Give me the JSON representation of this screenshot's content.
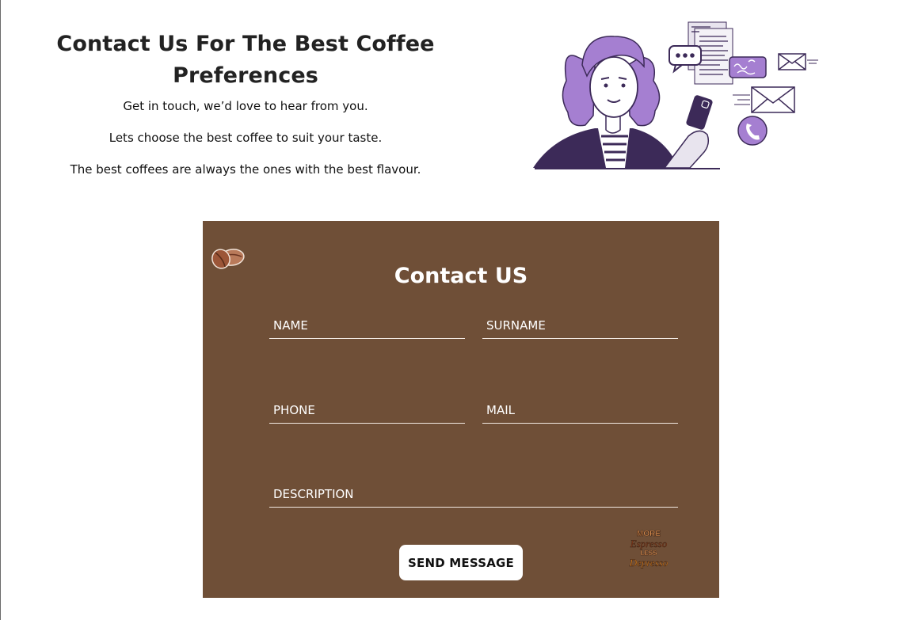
{
  "hero": {
    "title": "Contact Us For The Best Coffee Preferences",
    "line1": "Get in touch, we’d love to hear from you.",
    "line2": "Lets choose the best coffee to suit your taste.",
    "line3": "The best coffees are always the ones with the best flavour."
  },
  "illustration": {
    "name": "woman-with-phone-contact-illustration",
    "colors": {
      "accent": "#a57fd1",
      "dark": "#3c2a58"
    }
  },
  "form": {
    "title": "Contact US",
    "background": "#6f4f37",
    "fields": {
      "name_placeholder": "NAME",
      "surname_placeholder": "SURNAME",
      "phone_placeholder": "PHONE",
      "mail_placeholder": "MAIL",
      "description_placeholder": "DESCRIPTION"
    },
    "submit_label": "SEND MESSAGE",
    "decor": {
      "beans_icon": "coffee-beans-icon",
      "sticker_icon": "espresso-sticker-icon",
      "sticker_text": [
        "MORE",
        "Espresso",
        "LESS",
        "Depresso"
      ]
    }
  }
}
